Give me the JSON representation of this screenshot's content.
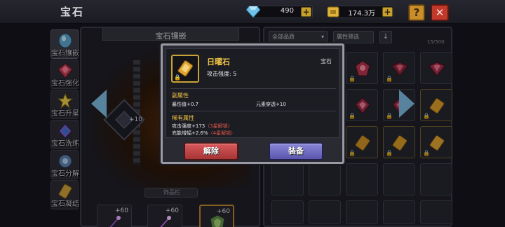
{
  "header": {
    "title": "宝石",
    "diamonds": "490",
    "gold": "174.3万",
    "help_label": "?",
    "close_label": "✕"
  },
  "tabs": [
    {
      "label": "宝石镶嵌"
    },
    {
      "label": "宝石强化"
    },
    {
      "label": "宝石升星"
    },
    {
      "label": "宝石洗练"
    },
    {
      "label": "宝石分解"
    },
    {
      "label": "宝石凝结"
    }
  ],
  "socket": {
    "header": "宝石镶嵌",
    "slot_level": "+10",
    "bottom_tab": "饰品栏",
    "slots": [
      {
        "level": "+60",
        "stars": "★★★★★"
      },
      {
        "level": "+60",
        "stars": "★★★★★"
      },
      {
        "level": "+60",
        "stars": "★★★★★"
      }
    ]
  },
  "inventory": {
    "filter_quality": "全部品质",
    "filter_attr": "属性筛选",
    "sort_icon": "↓",
    "count": "15/500"
  },
  "tooltip": {
    "name": "日曜石",
    "type": "宝石",
    "main_stat": "攻击强度: 5",
    "secondary_title": "副属性",
    "secondary_1": "暴伤值+0.7",
    "secondary_2": "元素穿透+10",
    "rare_title": "稀有属性",
    "rare_1": "攻击强度+173",
    "rare_1_lock": "（3星解锁）",
    "rare_2": "充能增幅+2.6%",
    "rare_2_lock": "（4星解锁）",
    "unload_label": "解除",
    "equip_label": "装备"
  },
  "colors": {
    "gold_text": "#f0c446",
    "locked_text": "#e05a4a",
    "unload_button": "#c4484a",
    "equip_button": "#7471c6"
  },
  "icons": [
    "diamond-icon",
    "gold-coin-icon",
    "help-icon",
    "close-icon",
    "scroll-gem-icon",
    "lock-icon"
  ]
}
